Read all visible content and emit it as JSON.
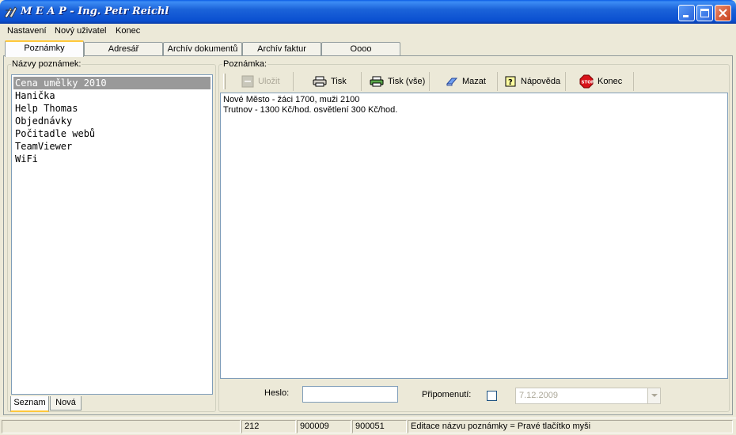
{
  "window": {
    "title": "M E A P - Ing. Petr Reichl"
  },
  "menu": {
    "items": [
      {
        "label": "Nastavení"
      },
      {
        "label": "Nový uživatel"
      },
      {
        "label": "Konec"
      }
    ]
  },
  "tabs": [
    {
      "label": "Poznámky",
      "active": true
    },
    {
      "label": "Adresář"
    },
    {
      "label": "Archív dokumentů"
    },
    {
      "label": "Archív faktur"
    },
    {
      "label": "Oooo"
    }
  ],
  "notes_panel": {
    "label": "Názvy poznámek:",
    "items": [
      "Cena umělky 2010",
      "Hanička",
      "Help Thomas",
      "Objednávky",
      "Počitadle webů",
      "TeamViewer",
      "WiFi"
    ],
    "subtabs": [
      {
        "label": "Seznam",
        "active": true
      },
      {
        "label": "Nová"
      }
    ]
  },
  "note_panel": {
    "label": "Poznámka:",
    "toolbar": [
      {
        "label": "Uložit",
        "icon": "save-icon",
        "enabled": false
      },
      {
        "label": "Tisk",
        "icon": "printer-icon"
      },
      {
        "label": "Tisk (vše)",
        "icon": "printer-all-icon"
      },
      {
        "label": "Mazat",
        "icon": "eraser-icon"
      },
      {
        "label": "Nápověda",
        "icon": "help-icon"
      },
      {
        "label": "Konec",
        "icon": "stop-icon"
      }
    ],
    "content": [
      "Nové Město - žáci 1700, muži 2100",
      "Trutnov - 1300 Kč/hod. osvětlení 300 Kč/hod."
    ],
    "password_label": "Heslo:",
    "password_value": "",
    "reminder_label": "Připomenutí:",
    "reminder_checked": false,
    "reminder_date": "7.12.2009"
  },
  "status": [
    "",
    "212",
    "900009",
    "900051",
    "Editace názvu poznámky = Pravé tlačítko myši"
  ],
  "colors": {
    "titlebar": "#0a4fd0",
    "selection": "#999999",
    "tab_highlight": "#ffc83c"
  }
}
